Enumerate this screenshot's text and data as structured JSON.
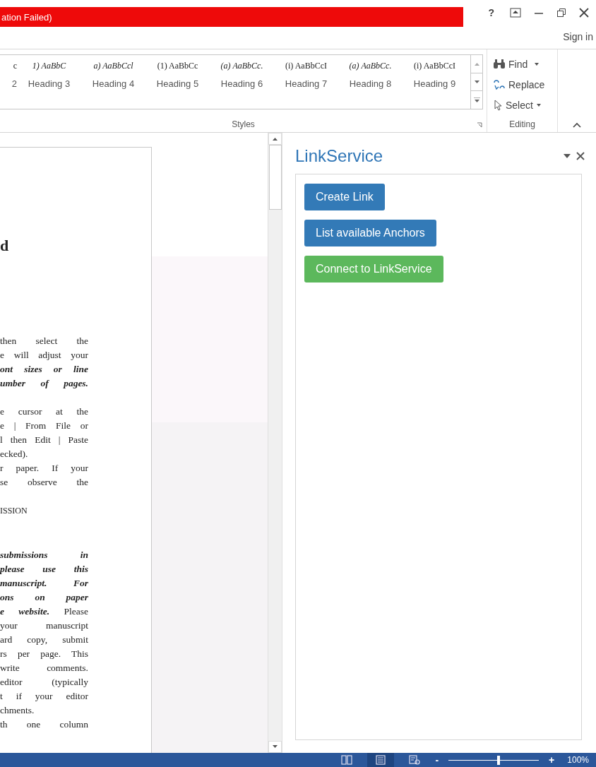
{
  "title_bar": {
    "banner": "ation Failed)",
    "buttons": [
      "?"
    ],
    "sign_in": "Sign in"
  },
  "ribbon": {
    "styles": [
      {
        "preview": "c",
        "name": "2",
        "italic": false
      },
      {
        "preview": "1) AaBbC",
        "name": "Heading 3",
        "italic": true
      },
      {
        "preview": "a) AaBbCcl",
        "name": "Heading 4",
        "italic": true
      },
      {
        "preview": "(1) AaBbCc",
        "name": "Heading 5",
        "italic": false
      },
      {
        "preview": "(a) AaBbCc.",
        "name": "Heading 6",
        "italic": true
      },
      {
        "preview": "(i) AaBbCcI",
        "name": "Heading 7",
        "italic": false
      },
      {
        "preview": "(a) AaBbCc.",
        "name": "Heading 8",
        "italic": true
      },
      {
        "preview": "(i) AaBbCcI",
        "name": "Heading 9",
        "italic": false
      }
    ],
    "styles_label": "Styles",
    "editing": {
      "find": "Find",
      "replace": "Replace",
      "select": "Select",
      "label": "Editing"
    }
  },
  "document": {
    "heading": "d",
    "blocks": [
      {
        "lines": [
          {
            "text": "then select the",
            "kind": "full",
            "emphasis": false
          },
          {
            "text": "e will adjust your",
            "kind": "full",
            "emphasis": false
          },
          {
            "text": "ont sizes or line",
            "kind": "full",
            "emphasis": true
          },
          {
            "text": "umber of pages.",
            "kind": "full",
            "emphasis": true
          }
        ]
      },
      {
        "lines": [
          {
            "text": "e cursor at the",
            "kind": "full",
            "emphasis": false
          },
          {
            "text": "e | From File or",
            "kind": "full",
            "emphasis": false
          },
          {
            "text": "l then Edit | Paste",
            "kind": "full",
            "emphasis": false
          },
          {
            "text": "ecked).",
            "kind": "last",
            "emphasis": false
          },
          {
            "text": "r paper. If your",
            "kind": "full",
            "emphasis": false
          },
          {
            "text": "se observe the",
            "kind": "full",
            "emphasis": false
          }
        ]
      },
      {
        "lines": [
          {
            "text": "ISSION",
            "kind": "caps",
            "emphasis": false
          }
        ]
      },
      {
        "lines": [
          {
            "text": "submissions in",
            "kind": "full",
            "emphasis": true
          },
          {
            "text": "please use this",
            "kind": "full",
            "emphasis": true
          },
          {
            "text": "manuscript. For",
            "kind": "full",
            "emphasis": true
          },
          {
            "text": "ons on paper",
            "kind": "full",
            "emphasis": true
          },
          {
            "text": "e website.",
            "tail": "Please",
            "kind": "full",
            "emphasis": true
          },
          {
            "text": "your manuscript",
            "kind": "full",
            "emphasis": false
          },
          {
            "text": "ard copy, submit",
            "kind": "full",
            "emphasis": false
          },
          {
            "text": "rs per page. This",
            "kind": "full",
            "emphasis": false
          },
          {
            "text": "write comments.",
            "kind": "full",
            "emphasis": false
          },
          {
            "text": "editor (typically",
            "kind": "full",
            "emphasis": false
          },
          {
            "text": "t if your editor",
            "kind": "full",
            "emphasis": false
          },
          {
            "text": "chments.",
            "kind": "last",
            "emphasis": false
          },
          {
            "text": "th one column",
            "kind": "full",
            "emphasis": false
          }
        ]
      }
    ]
  },
  "task_pane": {
    "title": "LinkService",
    "buttons": [
      {
        "label": "Create Link",
        "kind": "primary"
      },
      {
        "label": "List available Anchors",
        "kind": "primary"
      },
      {
        "label": "Connect to LinkService",
        "kind": "success"
      }
    ]
  },
  "status_bar": {
    "zoom": {
      "out": "-",
      "in": "+",
      "level": 0.55,
      "reading": "100%"
    },
    "views": [
      {
        "selected": false
      },
      {
        "selected": true
      },
      {
        "selected": false
      }
    ]
  }
}
